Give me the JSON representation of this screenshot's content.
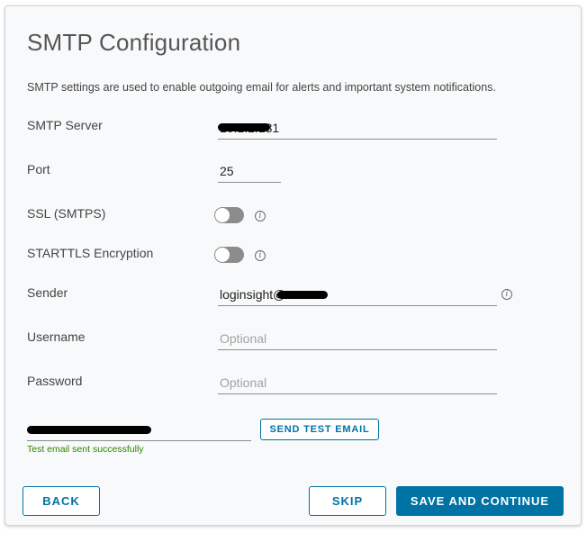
{
  "title": "SMTP Configuration",
  "description": "SMTP settings are used to enable outgoing email for alerts and important system notifications.",
  "fields": {
    "smtp_server": {
      "label": "SMTP Server",
      "value": "10.1.2.131"
    },
    "port": {
      "label": "Port",
      "value": "25"
    },
    "ssl": {
      "label": "SSL (SMTPS)",
      "enabled": false
    },
    "starttls": {
      "label": "STARTTLS Encryption",
      "enabled": false
    },
    "sender": {
      "label": "Sender",
      "value": "loginsight@"
    },
    "username": {
      "label": "Username",
      "placeholder": "Optional"
    },
    "password": {
      "label": "Password",
      "placeholder": "Optional"
    }
  },
  "test_email": {
    "value": "",
    "button_label": "SEND TEST EMAIL",
    "status": "Test email sent successfully"
  },
  "buttons": {
    "back": "BACK",
    "skip": "SKIP",
    "save": "SAVE AND CONTINUE"
  },
  "colors": {
    "accent": "#0072a3",
    "success": "#2e8500",
    "toggle_off": "#8c8c8c"
  },
  "icons": {
    "info": "info-icon"
  }
}
